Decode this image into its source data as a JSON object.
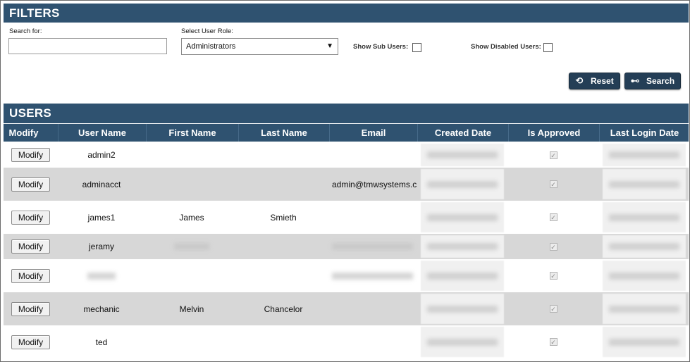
{
  "filters": {
    "title": "FILTERS",
    "search_label": "Search for:",
    "search_value": "",
    "role_label": "Select User Role:",
    "role_value": "Administrators",
    "show_sub_users_label": "Show Sub Users:",
    "show_disabled_users_label": "Show Disabled Users:",
    "reset_label": "Reset",
    "search_button_label": "Search"
  },
  "users": {
    "title": "USERS",
    "columns": [
      "Modify",
      "User Name",
      "First Name",
      "Last Name",
      "Email",
      "Created Date",
      "Is Approved",
      "Last Login Date"
    ],
    "modify_label": "Modify",
    "rows": [
      {
        "username": "admin2",
        "first": "",
        "last": "",
        "email": "",
        "approved": true
      },
      {
        "username": "adminacct",
        "first": "",
        "last": "",
        "email": "admin@tmwsystems.c",
        "approved": true
      },
      {
        "username": "james1",
        "first": "James",
        "last": "Smieth",
        "email": "",
        "approved": true
      },
      {
        "username": "jeramy",
        "first": "",
        "last": "",
        "email": "",
        "approved": true
      },
      {
        "username": "",
        "first": "",
        "last": "",
        "email": "",
        "approved": true
      },
      {
        "username": "mechanic",
        "first": "Melvin",
        "last": "Chancelor",
        "email": "",
        "approved": true
      },
      {
        "username": "ted",
        "first": "",
        "last": "",
        "email": "",
        "approved": true
      }
    ]
  }
}
